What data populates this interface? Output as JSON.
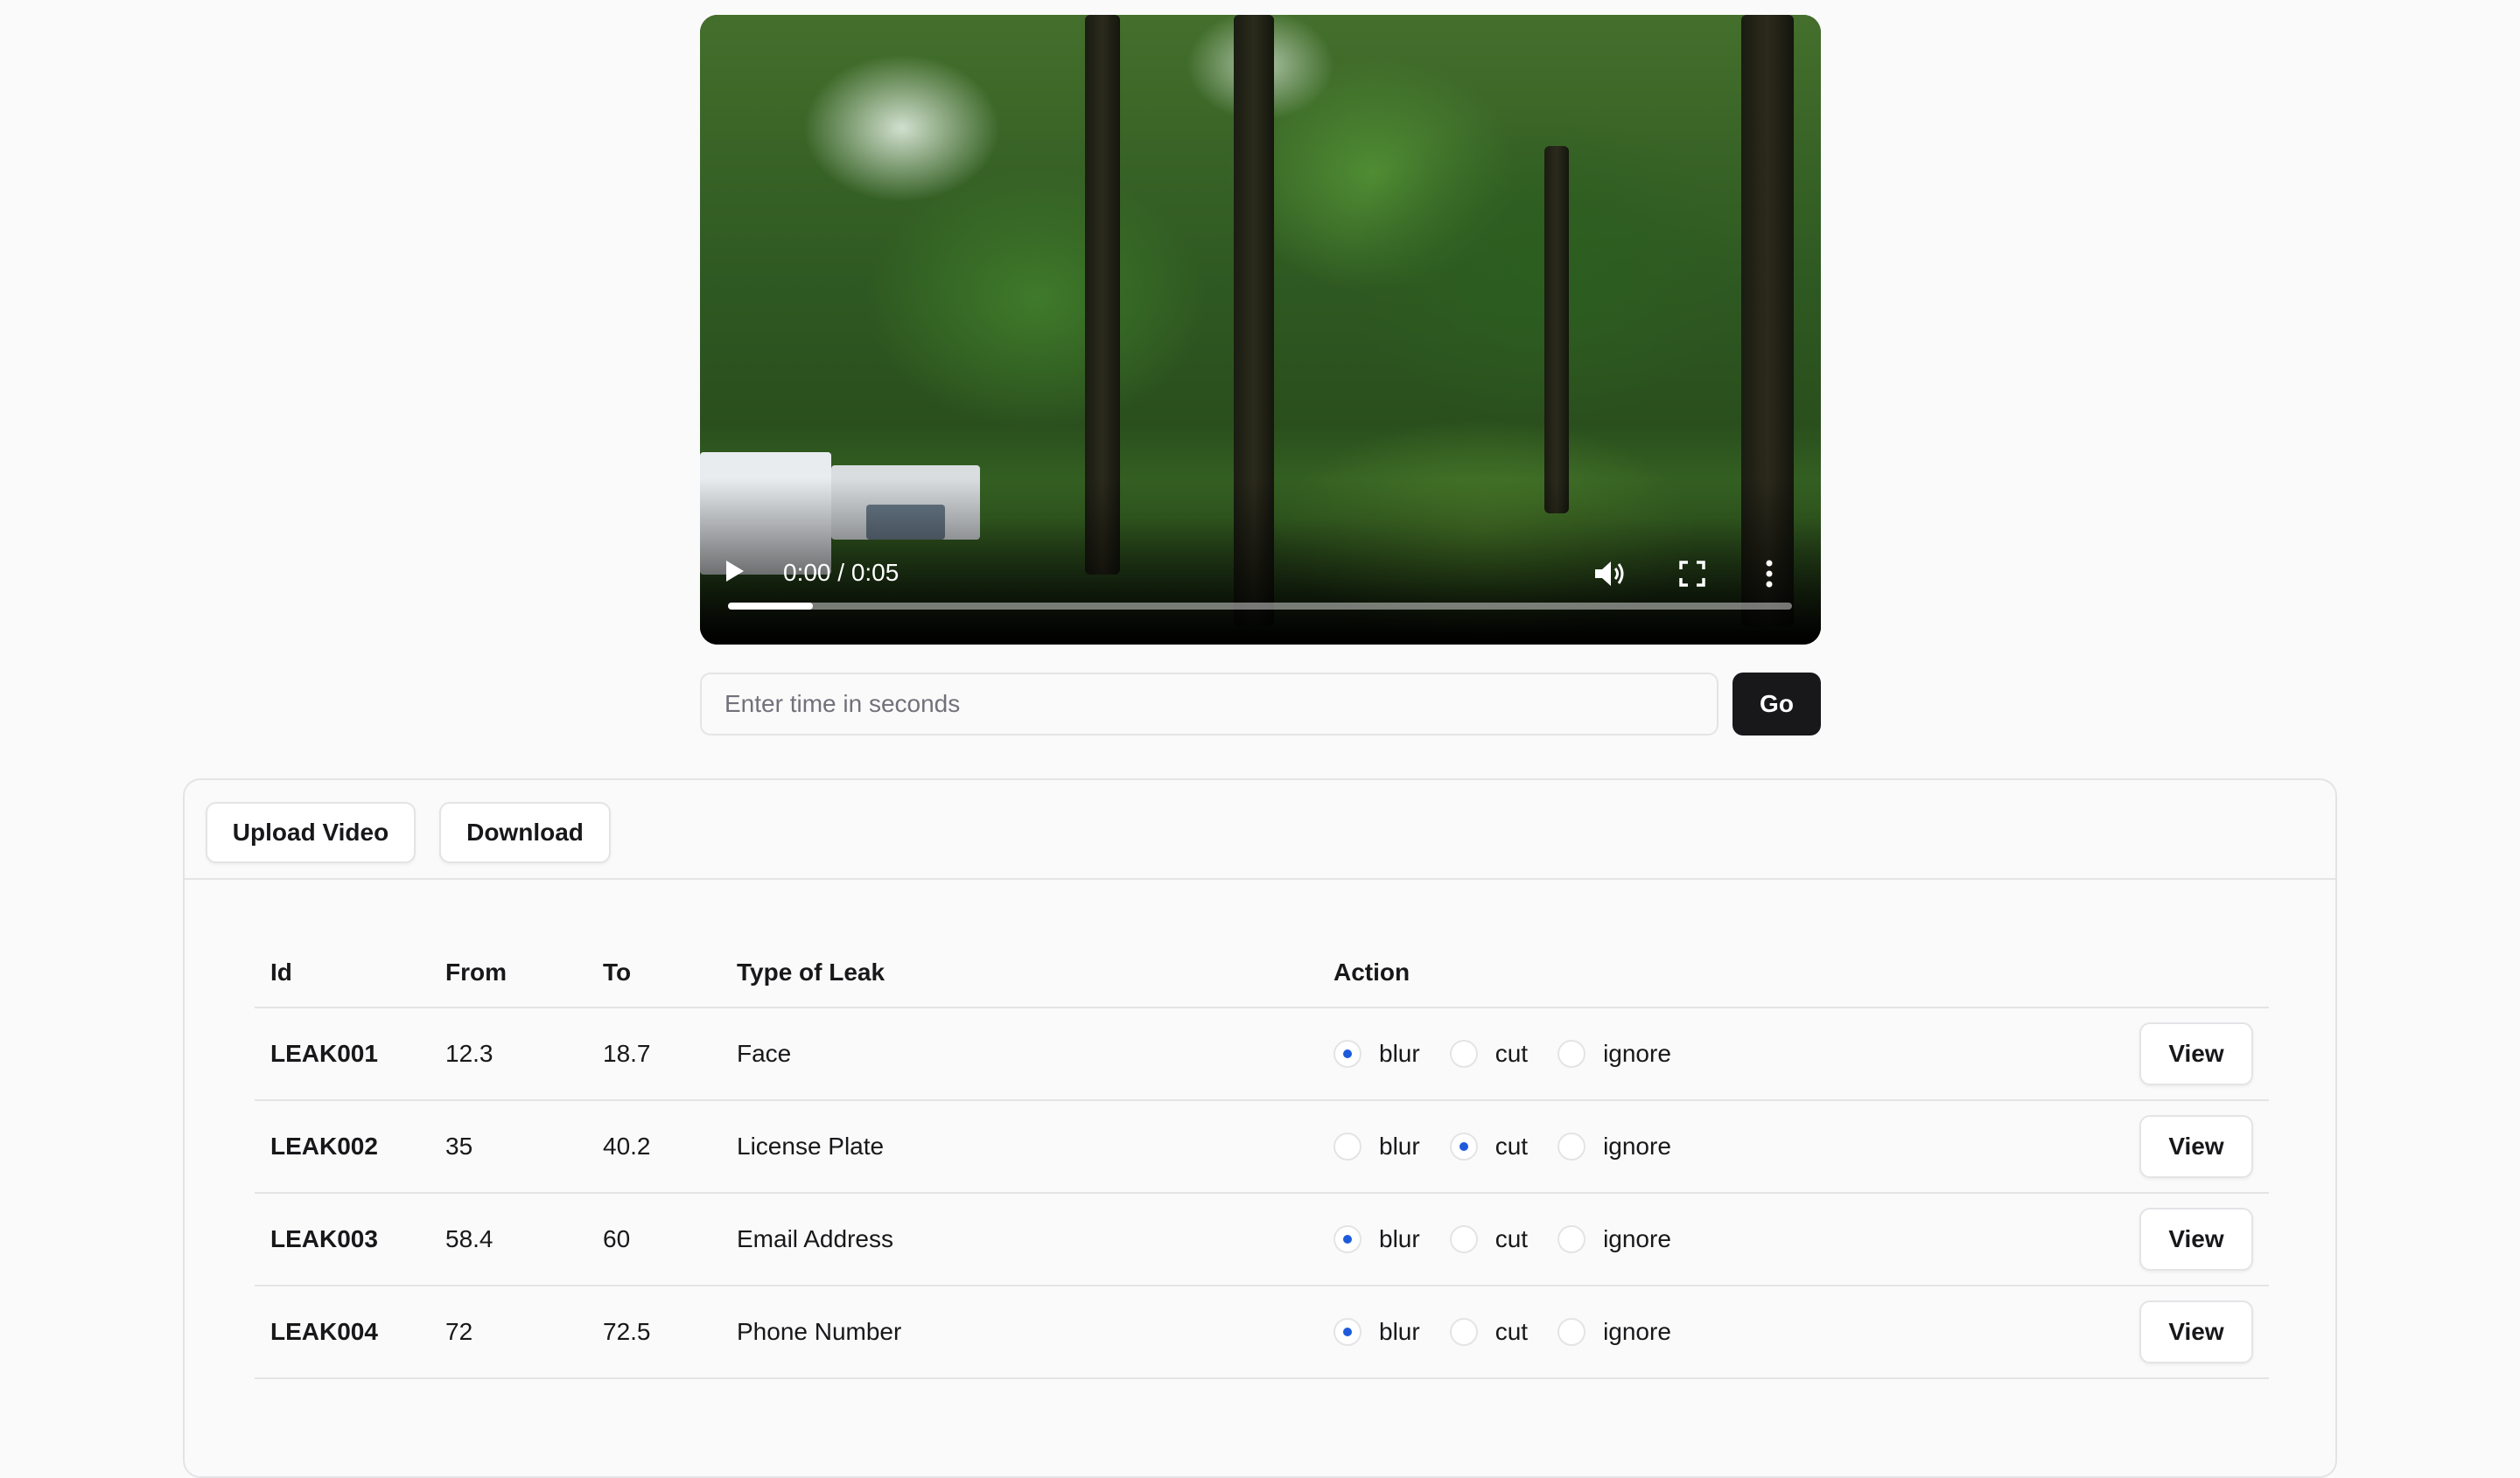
{
  "player": {
    "time_display": "0:00 / 0:05",
    "progress_fraction": 0.08,
    "icons": {
      "play": "play-icon",
      "volume": "volume-icon",
      "fullscreen": "fullscreen-icon",
      "more": "more-vertical-icon"
    }
  },
  "seek": {
    "placeholder": "Enter time in seconds",
    "value": "",
    "go_label": "Go"
  },
  "toolbar": {
    "upload_label": "Upload Video",
    "download_label": "Download"
  },
  "table": {
    "headers": {
      "id": "Id",
      "from": "From",
      "to": "To",
      "type": "Type of Leak",
      "action": "Action"
    },
    "action_options": [
      "blur",
      "cut",
      "ignore"
    ],
    "view_label": "View",
    "rows": [
      {
        "id": "LEAK001",
        "from": "12.3",
        "to": "18.7",
        "type": "Face",
        "selected": "blur"
      },
      {
        "id": "LEAK002",
        "from": "35",
        "to": "40.2",
        "type": "License Plate",
        "selected": "cut"
      },
      {
        "id": "LEAK003",
        "from": "58.4",
        "to": "60",
        "type": "Email Address",
        "selected": "blur"
      },
      {
        "id": "LEAK004",
        "from": "72",
        "to": "72.5",
        "type": "Phone Number",
        "selected": "blur"
      }
    ]
  },
  "colors": {
    "accent": "#1d5bdb",
    "primary_button": "#18181b",
    "border": "#e4e4e7",
    "background": "#fafafa"
  }
}
